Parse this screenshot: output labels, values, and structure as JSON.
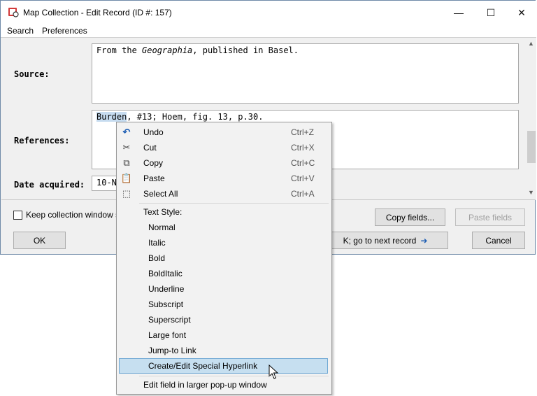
{
  "window": {
    "title": "Map Collection - Edit Record (ID #: 157)",
    "minimize": "—",
    "maximize": "☐",
    "close": "✕"
  },
  "menu": [
    "Search",
    "Preferences"
  ],
  "fields": {
    "source_label": "Source:",
    "source_prefix": "From the ",
    "source_italic": "Geographia",
    "source_suffix": ", published in Basel.",
    "references_label": "References:",
    "references_selected": "Burden",
    "references_rest": ", #13; Hoem, fig. 13, p.30.",
    "date_label": "Date acquired:",
    "date_value": "10-No"
  },
  "bottom": {
    "keep_label": "Keep collection window s",
    "copy_fields": "Copy fields...",
    "paste_fields": "Paste fields",
    "ok": "OK",
    "next_record": "K; go to next record",
    "next_arrow": "➜",
    "cancel": "Cancel"
  },
  "context_menu": {
    "edit_items": [
      {
        "label": "Undo",
        "shortcut": "Ctrl+Z",
        "icon": "undo-icon"
      },
      {
        "label": "Cut",
        "shortcut": "Ctrl+X",
        "icon": "cut-icon"
      },
      {
        "label": "Copy",
        "shortcut": "Ctrl+C",
        "icon": "copy-icon"
      },
      {
        "label": "Paste",
        "shortcut": "Ctrl+V",
        "icon": "paste-icon"
      },
      {
        "label": "Select All",
        "shortcut": "Ctrl+A",
        "icon": "select-all-icon"
      }
    ],
    "text_style_header": "Text Style:",
    "styles": [
      "Normal",
      "Italic",
      "Bold",
      "BoldItalic",
      "Underline",
      "Subscript",
      "Superscript",
      "Large font",
      "Jump-to Link",
      "Create/Edit Special Hyperlink"
    ],
    "highlighted": "Create/Edit Special Hyperlink",
    "popup": "Edit field in larger pop-up window"
  },
  "colors": {
    "selection": "#c7dcf0",
    "menu_highlight": "#c6dff0",
    "arrow_blue": "#1f5fb4"
  }
}
